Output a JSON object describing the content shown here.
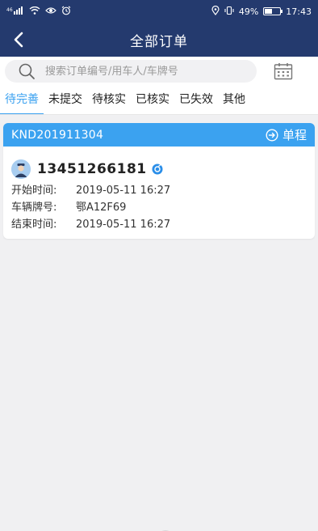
{
  "status_bar": {
    "signal_text": "46",
    "battery": "49%",
    "time": "17:43",
    "battery_level": 0.49
  },
  "header": {
    "title": "全部订单"
  },
  "search": {
    "placeholder": "搜索订单编号/用车人/车牌号"
  },
  "tabs": [
    {
      "label": "待完善",
      "active": true
    },
    {
      "label": "未提交",
      "active": false
    },
    {
      "label": "待核实",
      "active": false
    },
    {
      "label": "已核实",
      "active": false
    },
    {
      "label": "已失效",
      "active": false
    },
    {
      "label": "其他",
      "active": false
    }
  ],
  "orders": [
    {
      "order_no": "KND201911304",
      "trip_type": "单程",
      "phone": "13451266181",
      "fields": [
        {
          "label": "开始时间:",
          "value": "2019-05-11 16:27"
        },
        {
          "label": "车辆牌号:",
          "value": "鄂A12F69"
        },
        {
          "label": "结束时间:",
          "value": "2019-05-11 16:27"
        }
      ]
    }
  ],
  "colors": {
    "header_bg": "#243a6e",
    "accent": "#3ba2f0",
    "tab_active": "#3aa1f0"
  },
  "icons": [
    "back-arrow-icon",
    "search-icon",
    "calendar-icon",
    "trip-arrow-icon",
    "avatar-icon",
    "verified-icon"
  ]
}
